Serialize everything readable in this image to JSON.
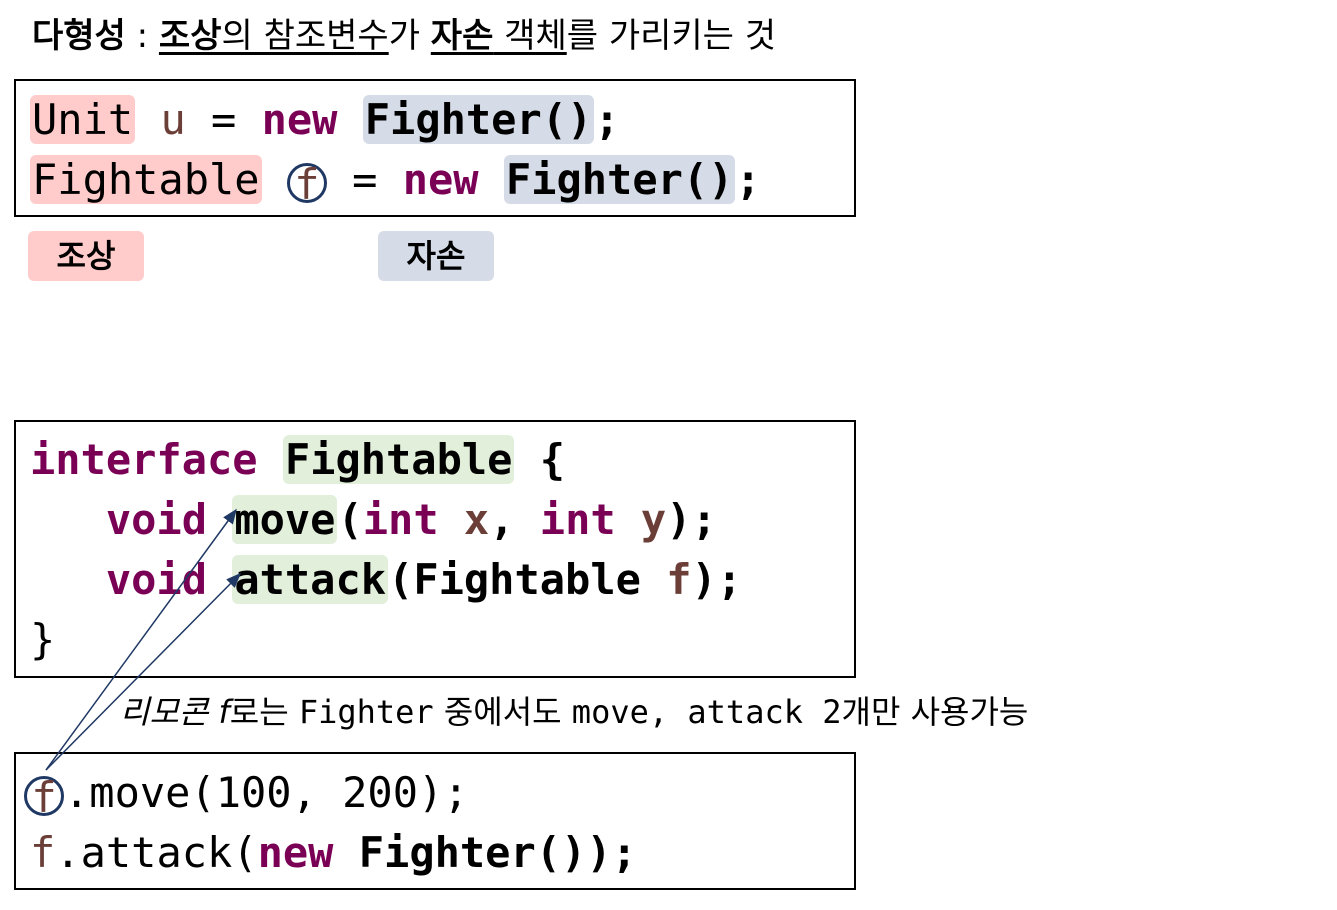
{
  "title": {
    "polymorphism": "다형성",
    "colon": " : ",
    "ancestor": "조상",
    "ref_var": "의 참조변수",
    "ga": "가 ",
    "descendant": "자손",
    "object": " 객체",
    "rest": "를 가리키는 것"
  },
  "box1": {
    "line1": {
      "type": "Unit",
      "var": " u",
      "eq": " = ",
      "kw": "new",
      "sp": " ",
      "ctor": "Fighter()",
      "end": ";"
    },
    "line2": {
      "type": "Fightable",
      "var": "f",
      "eq": " = ",
      "kw": "new",
      "sp": " ",
      "ctor": "Fighter()",
      "end": ";"
    }
  },
  "tags": {
    "ancestor": "조상",
    "descendant": "자손"
  },
  "box2": {
    "line1": {
      "kw": "interface",
      "sp": " ",
      "name": "Fightable",
      "brace": " {"
    },
    "line2": {
      "indent": "   ",
      "kw": "void",
      "sp": " ",
      "method": "move",
      "open": "(",
      "kw_int1": "int",
      "x": " x",
      "comma": ", ",
      "kw_int2": "int",
      "y": " y",
      "close": ");"
    },
    "line3": {
      "indent": "   ",
      "kw": "void",
      "sp": " ",
      "method": "attack",
      "open": "(",
      "type": "Fightable",
      "f": " f",
      "close": ");"
    },
    "line4": "}"
  },
  "note": {
    "italic": "리모콘 f",
    "text1": "로는 ",
    "fighter": "Fighter",
    "text2": " 중에서도 ",
    "methods": "move, attack 2",
    "text3": "개만 사용가능"
  },
  "box3": {
    "line1": {
      "f": "f",
      "call": ".move(100, 200);"
    },
    "line2": {
      "f": "f",
      "call": ".attack(",
      "kw": "new",
      "sp": " ",
      "ctor": "Fighter()",
      "end": ");"
    }
  },
  "colors": {
    "keyword": "#7a0055",
    "ancestor_hl": "#ffcccb",
    "descendant_hl": "#d6dce7",
    "method_hl": "#e2efda",
    "arrow": "#1f3864"
  }
}
